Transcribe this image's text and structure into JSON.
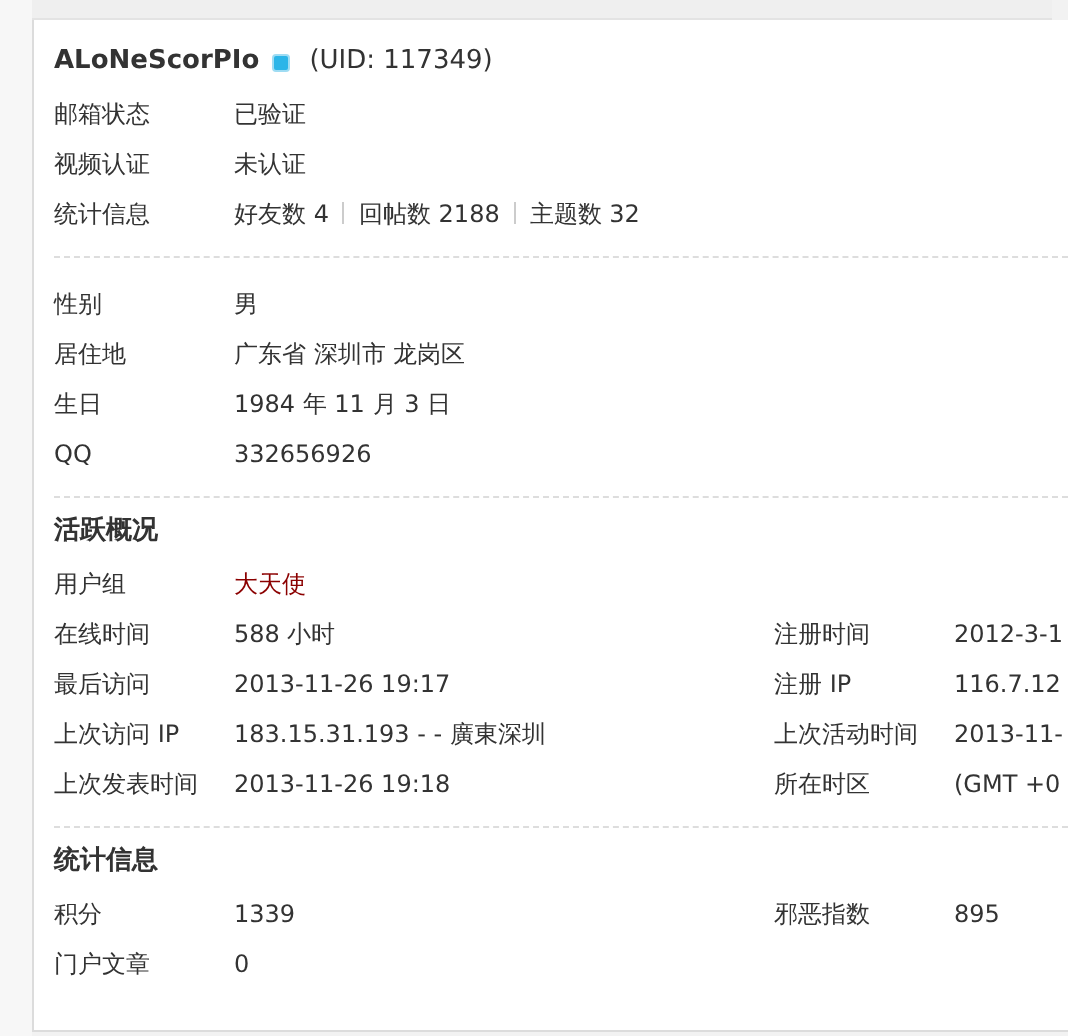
{
  "user": {
    "name": "ALoNeScorPIo",
    "online": true,
    "uid": "(UID: 117349)"
  },
  "account": [
    {
      "label": "邮箱状态",
      "value": "已验证"
    },
    {
      "label": "视频认证",
      "value": "未认证"
    }
  ],
  "stats_row": {
    "label": "统计信息",
    "items": [
      {
        "label": "好友数",
        "count": "4"
      },
      {
        "label": "回帖数",
        "count": "2188"
      },
      {
        "label": "主题数",
        "count": "32"
      }
    ]
  },
  "profile": [
    {
      "label": "性别",
      "value": "男"
    },
    {
      "label": "居住地",
      "value": "广东省 深圳市 龙岗区"
    },
    {
      "label": "生日",
      "value": "1984 年 11 月 3 日"
    },
    {
      "label": "QQ",
      "value": "332656926"
    }
  ],
  "sections": [
    {
      "heading": "活跃概况",
      "rows": [
        [
          {
            "label": "用户组",
            "value": "大天使",
            "kind": "group"
          }
        ],
        [
          {
            "label": "在线时间",
            "value": "588 小时",
            "kind": "text"
          },
          {
            "label": "注册时间",
            "value": "2012-3-1",
            "kind": "text"
          }
        ],
        [
          {
            "label": "最后访问",
            "value": "2013-11-26 19:17",
            "kind": "text"
          },
          {
            "label": "注册 IP",
            "value": "116.7.12",
            "kind": "text"
          }
        ],
        [
          {
            "label": "上次访问 IP",
            "value": "183.15.31.193 - - 廣東深圳",
            "kind": "text"
          },
          {
            "label": "上次活动时间",
            "value": "2013-11-",
            "kind": "text"
          }
        ],
        [
          {
            "label": "上次发表时间",
            "value": "2013-11-26 19:18",
            "kind": "text"
          },
          {
            "label": "所在时区",
            "value": "(GMT +0",
            "kind": "text"
          }
        ]
      ]
    },
    {
      "heading": "统计信息",
      "rows": [
        [
          {
            "label": "积分",
            "value": "1339",
            "kind": "text"
          },
          {
            "label": "邪恶指数",
            "value": "895",
            "kind": "text"
          }
        ],
        [
          {
            "label": "门户文章",
            "value": "0",
            "kind": "text"
          }
        ]
      ]
    }
  ]
}
